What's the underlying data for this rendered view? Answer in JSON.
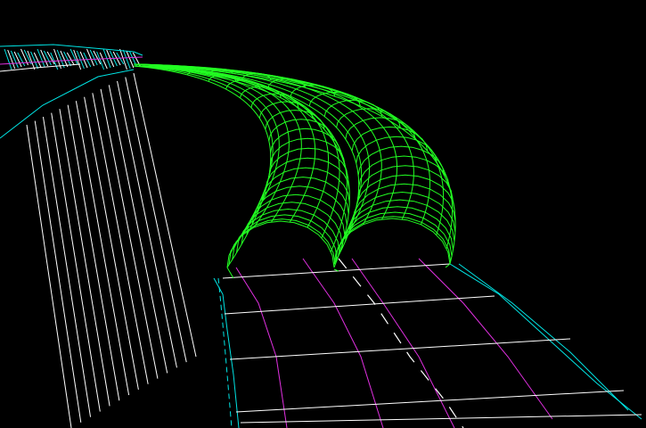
{
  "viewport": {
    "background": "#000000",
    "description_colors": {
      "tunnel_wireframe": "#22ff22",
      "embankment": "#ffffff",
      "road_edge": "#00e5e5",
      "lane_marking": "#e030e0",
      "road_grid": "#ffffff"
    }
  }
}
